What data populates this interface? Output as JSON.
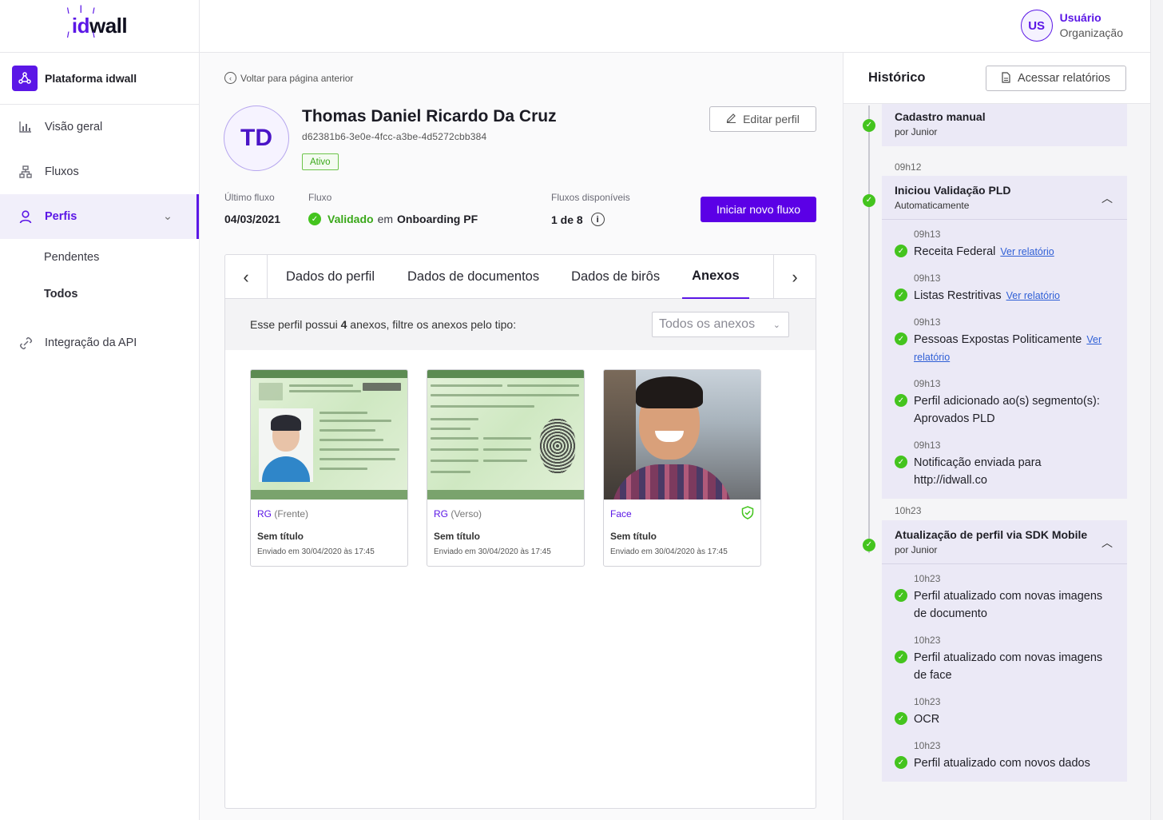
{
  "brand": {
    "logo_prefix": "id",
    "logo_suffix": "wall"
  },
  "platform": {
    "label": "Plataforma idwall"
  },
  "nav": {
    "overview": "Visão geral",
    "flows": "Fluxos",
    "profiles": "Perfis",
    "pending": "Pendentes",
    "all": "Todos",
    "api": "Integração da API"
  },
  "user": {
    "initials": "US",
    "name": "Usuário",
    "org": "Organização"
  },
  "page": {
    "back": "Voltar para página anterior",
    "profile_initials": "TD",
    "profile_name": "Thomas Daniel Ricardo Da Cruz",
    "profile_id": "d62381b6-3e0e-4fcc-a3be-4d5272cbb384",
    "status": "Ativo",
    "edit_button": "Editar perfil",
    "last_flow_label": "Último fluxo",
    "last_flow_value": "04/03/2021",
    "flow_label": "Fluxo",
    "flow_status": "Validado",
    "flow_in": "em",
    "flow_name": "Onboarding PF",
    "available_label": "Fluxos disponíveis",
    "available_value": "1 de 8",
    "start_button": "Iniciar novo fluxo"
  },
  "tabs": [
    "Dados do perfil",
    "Dados de documentos",
    "Dados de birôs",
    "Anexos"
  ],
  "filter": {
    "prefix": "Esse perfil possui",
    "count": "4",
    "suffix": "anexos, filtre os anexos pelo tipo:",
    "select_value": "Todos os anexos"
  },
  "attachments": [
    {
      "type": "RG",
      "subtype": "(Frente)",
      "title": "Sem título",
      "date": "Enviado em 30/04/2020 às 17:45"
    },
    {
      "type": "RG",
      "subtype": "(Verso)",
      "title": "Sem título",
      "date": "Enviado em 30/04/2020 às 17:45"
    },
    {
      "type": "Face",
      "subtype": "",
      "title": "Sem título",
      "date": "Enviado em 30/04/2020 às 17:45"
    }
  ],
  "history": {
    "title": "Histórico",
    "reports_button": "Acessar relatórios",
    "events": [
      {
        "title": "Cadastro manual",
        "by": "por Junior"
      },
      {
        "time": "09h12",
        "title": "Iniciou Validação PLD",
        "by": "Automaticamente",
        "items": [
          {
            "time": "09h13",
            "text": "Receita Federal",
            "link": "Ver relatório"
          },
          {
            "time": "09h13",
            "text": "Listas Restritivas",
            "link": "Ver relatório"
          },
          {
            "time": "09h13",
            "text": "Pessoas Expostas Politicamente",
            "link": "Ver relatório"
          },
          {
            "time": "09h13",
            "text": "Perfil adicionado ao(s) segmento(s): Aprovados PLD"
          },
          {
            "time": "09h13",
            "text": "Notificação enviada para http://idwall.co"
          }
        ]
      },
      {
        "time": "10h23",
        "title": "Atualização de perfil via SDK Mobile",
        "by": "por Junior",
        "items": [
          {
            "time": "10h23",
            "text": "Perfil atualizado com novas imagens de documento"
          },
          {
            "time": "10h23",
            "text": "Perfil atualizado com novas imagens de face"
          },
          {
            "time": "10h23",
            "text": "OCR"
          },
          {
            "time": "10h23",
            "text": "Perfil atualizado com novos dados"
          }
        ]
      }
    ]
  },
  "colors": {
    "accent": "#5b17e6",
    "success": "#44c41e",
    "link": "#2f5fd6"
  },
  "icons": [
    "chart-icon",
    "flows-icon",
    "user-icon",
    "api-icon",
    "back-icon",
    "pencil-icon",
    "info-icon",
    "shield-check-icon",
    "file-icon",
    "check-icon"
  ]
}
